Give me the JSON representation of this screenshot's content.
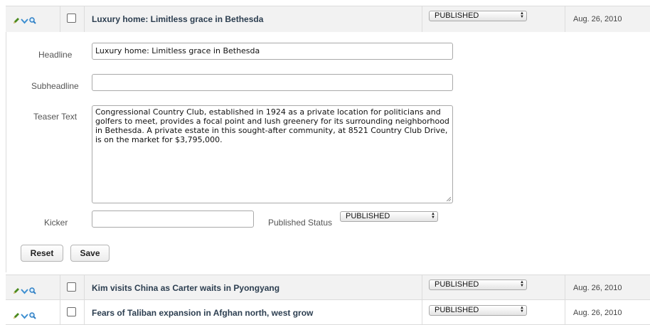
{
  "rows": [
    {
      "title": "Luxury home: Limitless grace in Bethesda",
      "status": "PUBLISHED",
      "date": "Aug. 26, 2010"
    },
    {
      "title": "Kim visits China as Carter waits in Pyongyang",
      "status": "PUBLISHED",
      "date": "Aug. 26, 2010"
    },
    {
      "title": "Fears of Taliban expansion in Afghan north, west grow",
      "status": "PUBLISHED",
      "date": "Aug. 26, 2010"
    }
  ],
  "editor": {
    "headline_label": "Headline",
    "headline_value": "Luxury home: Limitless grace in Bethesda",
    "subheadline_label": "Subheadline",
    "subheadline_value": "",
    "teaser_label": "Teaser Text",
    "teaser_value": "Congressional Country Club, established in 1924 as a private location for politicians and golfers to meet, provides a focal point and lush greenery for its surrounding neighborhood in Bethesda. A private estate in this sought-after community, at 8521 Country Club Drive, is on the market for $3,795,000.",
    "kicker_label": "Kicker",
    "kicker_value": "",
    "published_status_label": "Published Status",
    "published_status_value": "PUBLISHED",
    "reset_label": "Reset",
    "save_label": "Save"
  },
  "icons": {
    "edit": "pencil-icon",
    "expand": "chevron-down-icon",
    "preview": "magnifier-icon"
  },
  "colors": {
    "row_background": "#f2f2f2",
    "title_text": "#2c3e50",
    "pencil": "#4a8a1e",
    "chevron": "#3d8fd1",
    "magnifier": "#2f7fc4"
  }
}
